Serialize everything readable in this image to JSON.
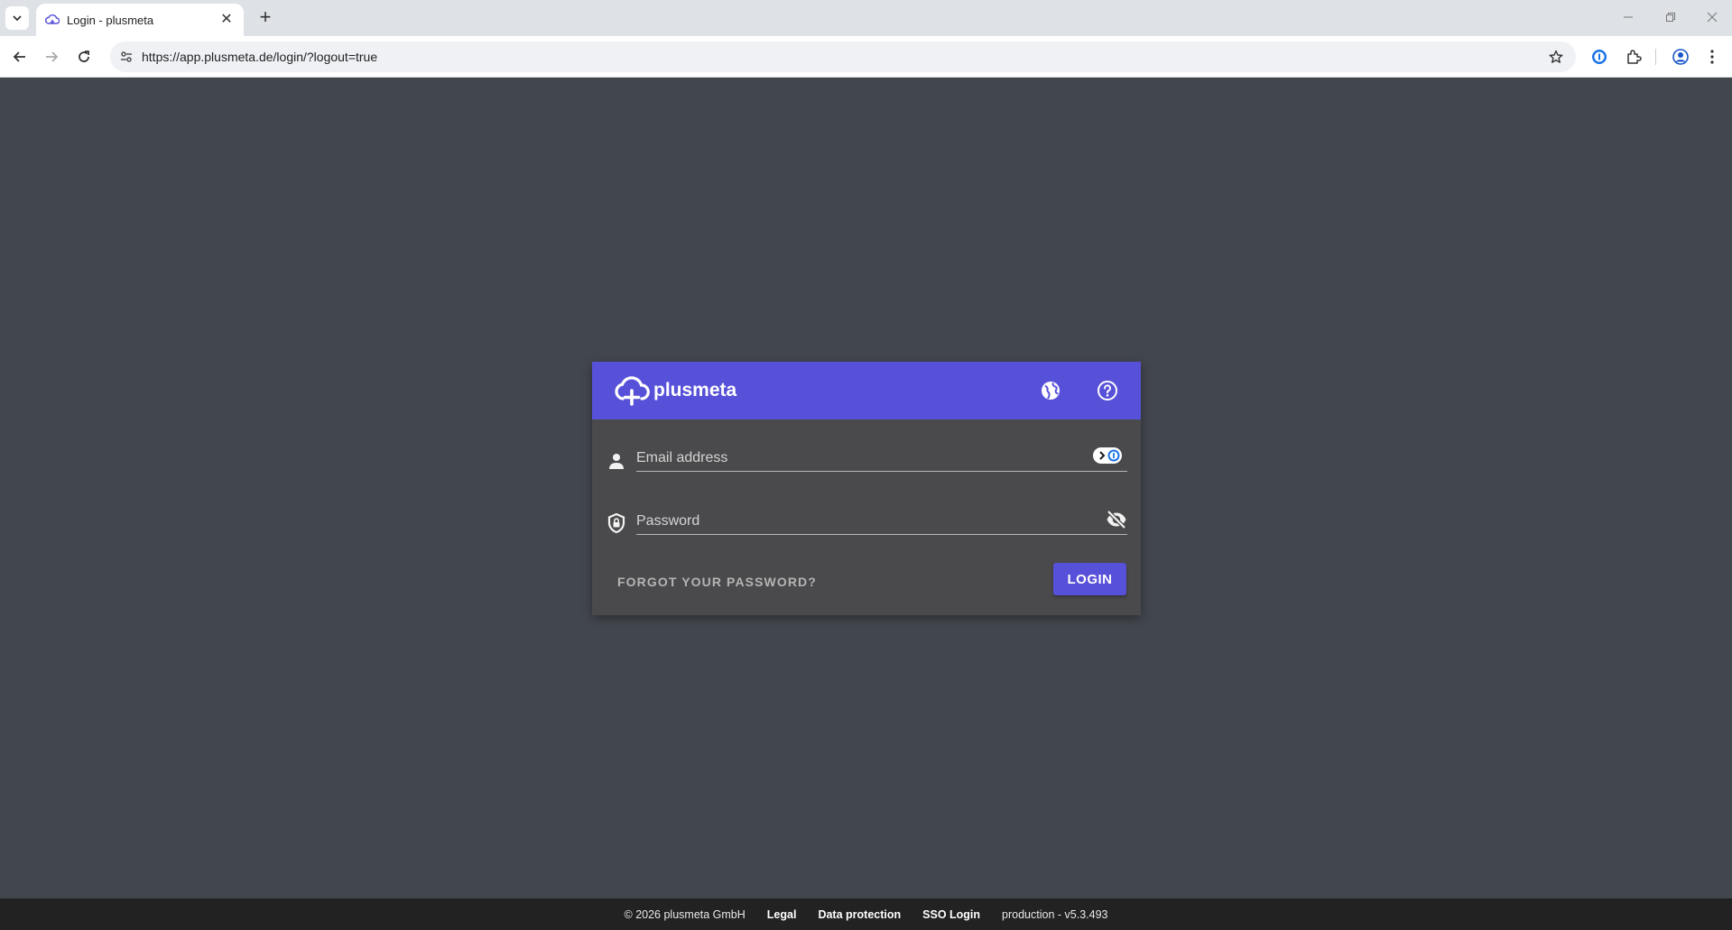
{
  "browser": {
    "tab_title": "Login - plusmeta",
    "new_tab": "+",
    "tab_close": "✕",
    "url": "https://app.plusmeta.de/login/?logout=true"
  },
  "header": {
    "brand": "plusmeta",
    "colors": {
      "accent": "#5750d8",
      "background": "#42464d",
      "card": "#4a4a4c"
    }
  },
  "form": {
    "email_placeholder": "Email address",
    "email_value": "",
    "password_placeholder": "Password",
    "password_value": "",
    "forgot_label": "FORGOT YOUR PASSWORD?",
    "login_label": "LOGIN"
  },
  "footer": {
    "copyright": "© 2026 plusmeta GmbH",
    "legal": "Legal",
    "data_protection": "Data protection",
    "sso_login": "SSO Login",
    "version": "production - v5.3.493"
  }
}
